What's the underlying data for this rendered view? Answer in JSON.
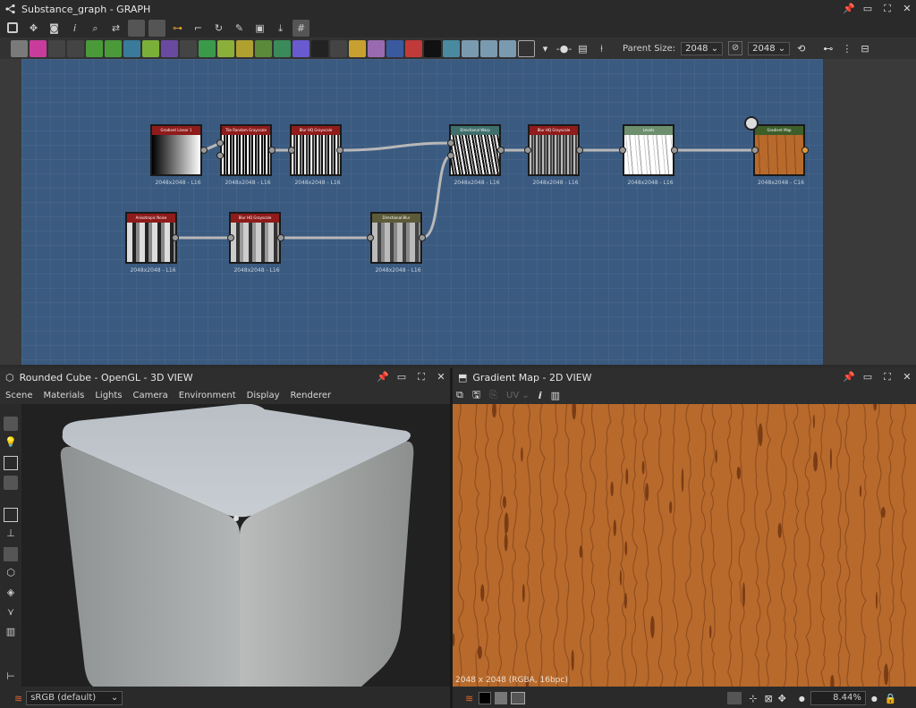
{
  "graph_panel": {
    "title": "Substance_graph - GRAPH",
    "parent_size_label": "Parent Size:",
    "parent_size_value": "2048",
    "size_value": "2048"
  },
  "nodes": [
    {
      "id": "gradient-linear",
      "title": "Gradient Linear 1",
      "caption": "2048x2048 - L16",
      "header_color": "#8f1b1b"
    },
    {
      "id": "tile-random",
      "title": "Tile Random Grayscale",
      "caption": "2048x2048 - L16",
      "header_color": "#8f1b1b"
    },
    {
      "id": "blur-hq-1",
      "title": "Blur HQ Grayscale",
      "caption": "2048x2048 - L16",
      "header_color": "#8f1b1b"
    },
    {
      "id": "directional-warp",
      "title": "Directional Warp",
      "caption": "2048x2048 - L16",
      "header_color": "#3f6f6b"
    },
    {
      "id": "blur-hq-2",
      "title": "Blur HQ Grayscale",
      "caption": "2048x2048 - L16",
      "header_color": "#8f1b1b"
    },
    {
      "id": "levels",
      "title": "Levels",
      "caption": "2048x2048 - L16",
      "header_color": "#6d8f6d"
    },
    {
      "id": "gradient-map",
      "title": "Gradient Map",
      "caption": "2048x2048 - C16",
      "header_color": "#3e5e2a"
    },
    {
      "id": "anisotropic-noise",
      "title": "Anisotropic Noise",
      "caption": "2048x2048 - L16",
      "header_color": "#8f1b1b"
    },
    {
      "id": "blur-hq-3",
      "title": "Blur HQ Grayscale",
      "caption": "2048x2048 - L16",
      "header_color": "#8f1b1b"
    },
    {
      "id": "directional-blur",
      "title": "Directional Blur",
      "caption": "2048x2048 - L16",
      "header_color": "#5d5a3a"
    }
  ],
  "view3d": {
    "title": "Rounded Cube - OpenGL - 3D VIEW",
    "menu": [
      "Scene",
      "Materials",
      "Lights",
      "Camera",
      "Environment",
      "Display",
      "Renderer"
    ],
    "colorspace": "sRGB (default)"
  },
  "view2d": {
    "title": "Gradient Map - 2D VIEW",
    "uv_label": "UV",
    "info": "2048 x 2048 (RGBA, 16bpc)",
    "zoom": "8.44%"
  },
  "colors": {
    "graph_bg": "#3a5a80",
    "panel_bg": "#2b2b2b",
    "wood": "#b86a2c",
    "wood_dark": "#8c4a1c"
  }
}
